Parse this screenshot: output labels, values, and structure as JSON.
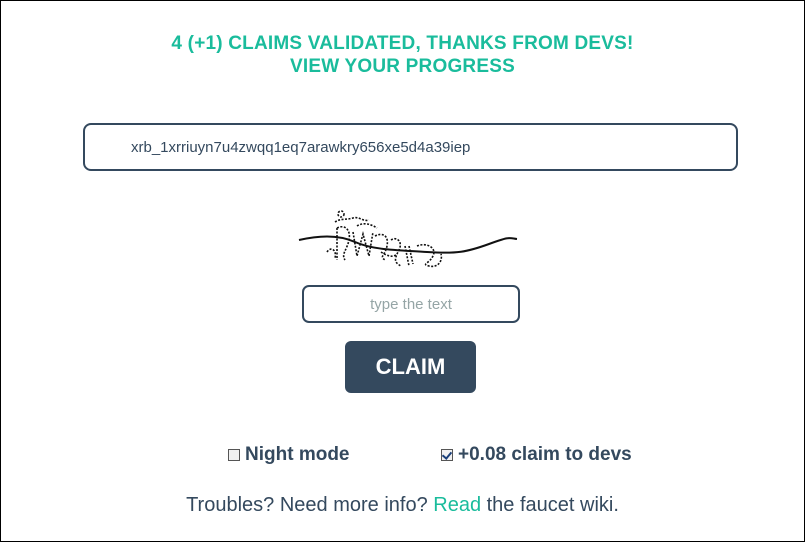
{
  "header": {
    "validated_text": "4 (+1) CLAIMS VALIDATED, THANKS FROM DEVS!",
    "progress_link": "VIEW YOUR PROGRESS"
  },
  "address_input": {
    "value": "xrb_1xrriuyn7u4zwqq1eq7arawkry656xe5d4a39iep"
  },
  "captcha": {
    "image_icon": "distorted-captcha-image",
    "placeholder": "type the text"
  },
  "claim_button": {
    "label": "CLAIM"
  },
  "options": {
    "night_mode": {
      "label": "Night mode",
      "checked": false
    },
    "claim_to_devs": {
      "label": "+0.08 claim to devs",
      "checked": true
    }
  },
  "footer": {
    "prefix": "Troubles? Need more info? ",
    "link_text": "Read",
    "suffix": " the faucet wiki."
  },
  "colors": {
    "accent": "#1abc9c",
    "dark": "#34495e"
  }
}
